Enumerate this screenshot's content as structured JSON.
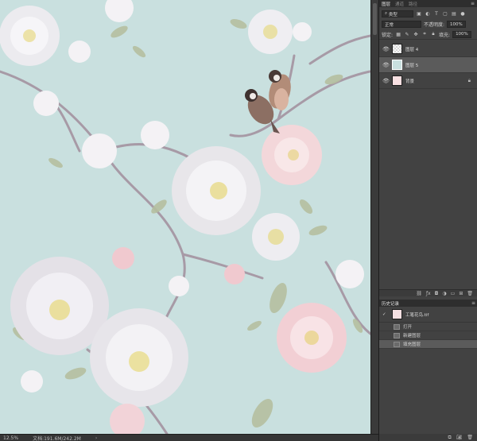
{
  "layers_panel": {
    "tabs": [
      "图层",
      "通道",
      "路径"
    ],
    "filter_value": "类型",
    "blend_mode": "正常",
    "opacity_label": "不透明度:",
    "opacity_value": "100%",
    "lock_label": "锁定:",
    "fill_label": "填充:",
    "fill_value": "100%",
    "layers": [
      {
        "name": "图层 4",
        "visible": true
      },
      {
        "name": "图层 5",
        "visible": true,
        "selected": true
      },
      {
        "name": "背景",
        "visible": true,
        "locked": true
      }
    ]
  },
  "history_panel": {
    "tab": "历史记录",
    "snapshot": "工笔花鸟.tif",
    "items": [
      "打开",
      "新建图层",
      "填充图层"
    ],
    "selected_index": 2
  },
  "status_bar": {
    "zoom": "12.5%",
    "doc_info": "文档:191.6M/242.2M"
  },
  "colors": {
    "canvas_bg": "#c9e0df",
    "panel_bg": "#424242",
    "selected_row": "#5b5b5b"
  }
}
